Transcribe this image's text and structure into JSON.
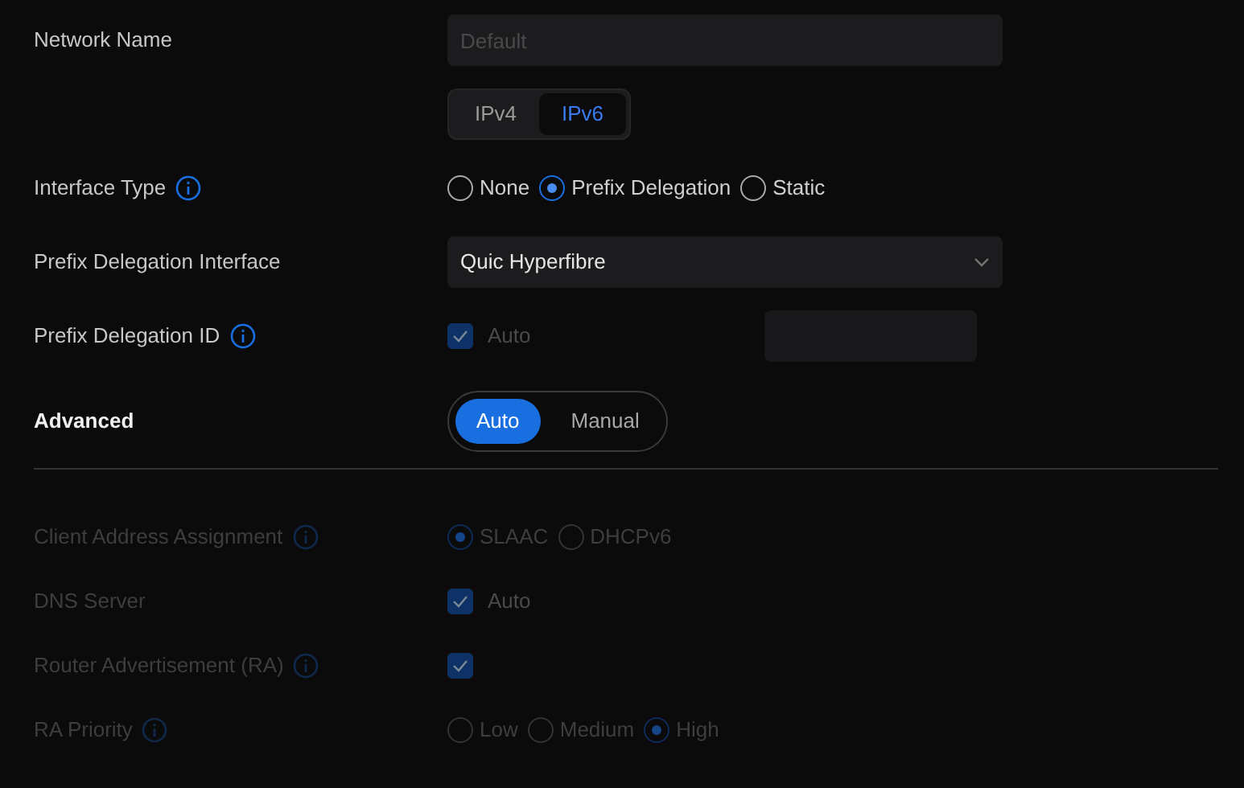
{
  "rows": [
    {
      "kind": "text",
      "label": "Network Name",
      "placeholder": "Default",
      "disabled": false
    },
    {
      "kind": "tabs",
      "tabs": [
        {
          "label": "IPv4",
          "selected": false
        },
        {
          "label": "IPv6",
          "selected": true
        }
      ],
      "disabled": false
    },
    {
      "kind": "radio",
      "label": "Interface Type",
      "info": true,
      "disabled": false,
      "options": [
        {
          "label": "None",
          "selected": false
        },
        {
          "label": "Prefix Delegation",
          "selected": true
        },
        {
          "label": "Static",
          "selected": false
        }
      ]
    },
    {
      "kind": "select",
      "label": "Prefix Delegation Interface",
      "value": "Quic Hyperfibre",
      "disabled": false
    },
    {
      "kind": "checkbox_field",
      "label": "Prefix Delegation ID",
      "info": true,
      "disabled": false,
      "checkbox": {
        "label": "Auto",
        "checked": true,
        "disabled": true
      }
    },
    {
      "kind": "segmented",
      "label": "Advanced",
      "disabled": false,
      "options": [
        {
          "label": "Auto",
          "selected": true
        },
        {
          "label": "Manual",
          "selected": false
        }
      ]
    },
    {
      "kind": "divider"
    },
    {
      "kind": "radio",
      "label": "Client Address Assignment",
      "info": true,
      "disabled": true,
      "options": [
        {
          "label": "SLAAC",
          "selected": true
        },
        {
          "label": "DHCPv6",
          "selected": false
        }
      ]
    },
    {
      "kind": "checkbox",
      "label": "DNS Server",
      "disabled": true,
      "checkbox": {
        "label": "Auto",
        "checked": true
      }
    },
    {
      "kind": "checkbox",
      "label": "Router Advertisement (RA)",
      "info": true,
      "disabled": true,
      "checkbox": {
        "checked": true
      }
    },
    {
      "kind": "radio",
      "label": "RA Priority",
      "info": true,
      "disabled": true,
      "options": [
        {
          "label": "Low",
          "selected": false
        },
        {
          "label": "Medium",
          "selected": false
        },
        {
          "label": "High",
          "selected": true
        }
      ]
    }
  ]
}
